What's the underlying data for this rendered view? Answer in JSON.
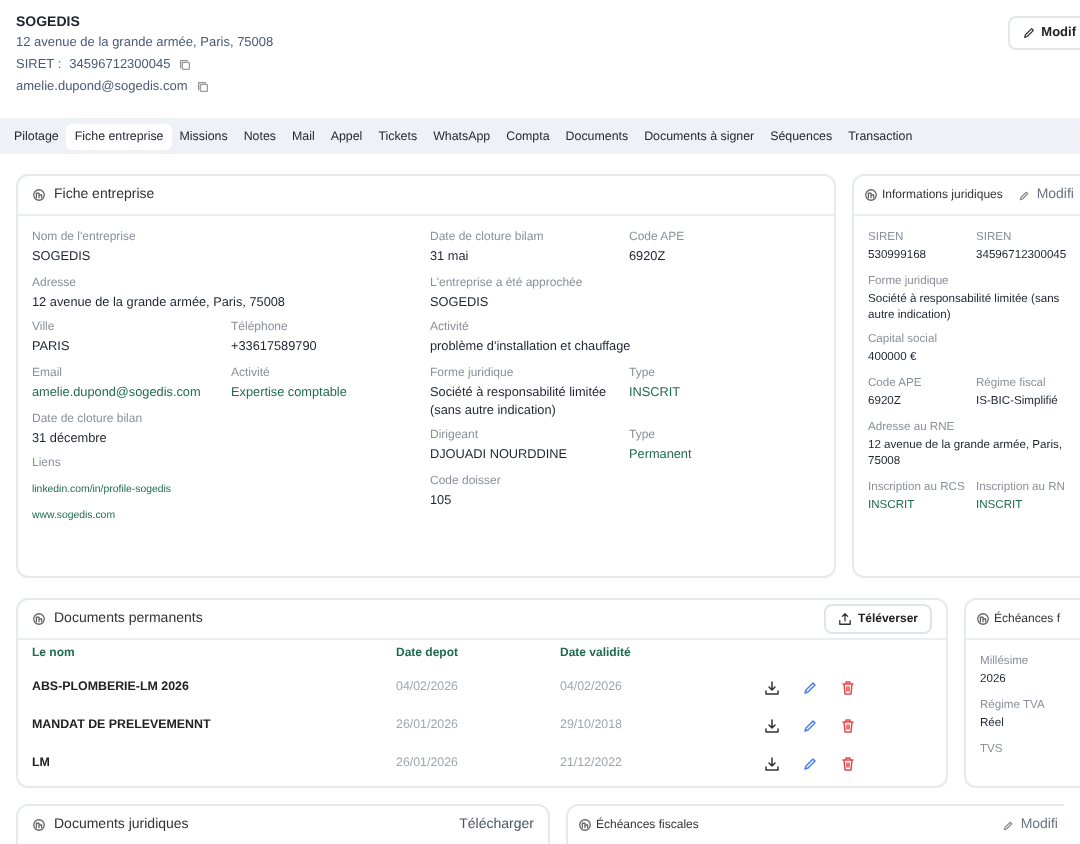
{
  "header": {
    "company": "SOGEDIS",
    "address": "12 avenue de la grande armée, Paris, 75008",
    "siret_label": "SIRET :",
    "siret": "34596712300045",
    "email": "amelie.dupond@sogedis.com",
    "edit_button": "Modif"
  },
  "tabs": [
    {
      "label": "Pilotage",
      "selected": false
    },
    {
      "label": "Fiche entreprise",
      "selected": true
    },
    {
      "label": "Missions",
      "selected": false
    },
    {
      "label": "Notes",
      "selected": false
    },
    {
      "label": "Mail",
      "selected": false
    },
    {
      "label": "Appel",
      "selected": false
    },
    {
      "label": "Tickets",
      "selected": false
    },
    {
      "label": "WhatsApp",
      "selected": false
    },
    {
      "label": "Compta",
      "selected": false
    },
    {
      "label": "Documents",
      "selected": false
    },
    {
      "label": "Documents à signer",
      "selected": false
    },
    {
      "label": "Séquences",
      "selected": false
    },
    {
      "label": "Transaction",
      "selected": false
    }
  ],
  "company_card": {
    "title": "Fiche entreprise",
    "left_rows": [
      [
        {
          "label": "Nom de l'entreprise",
          "value": "SOGEDIS",
          "highlight": false
        }
      ],
      [
        {
          "label": "Adresse",
          "value": "12 avenue de la grande armée, Paris, 75008",
          "highlight": false
        }
      ],
      [
        {
          "label": "Ville",
          "value": "PARIS",
          "highlight": false
        },
        {
          "label": "Téléphone",
          "value": "+33617589790",
          "highlight": false
        }
      ],
      [
        {
          "label": "Email",
          "value": "amelie.dupond@sogedis.com",
          "highlight": true
        },
        {
          "label": "Activité",
          "value": "Expertise comptable",
          "highlight": true
        }
      ],
      [
        {
          "label": "Date de cloture bilan",
          "value": "31 décembre",
          "highlight": false
        }
      ],
      [
        {
          "label": "Liens",
          "links": [
            "linkedin.com/in/profile-sogedis",
            "www.sogedis.com"
          ]
        }
      ]
    ],
    "right_rows": [
      [
        {
          "label": "Date de cloture bilam",
          "value": "31 mai",
          "highlight": false
        },
        {
          "label": "Code APE",
          "value": "6920Z",
          "highlight": false
        }
      ],
      [
        {
          "label": "L'entreprise a été approchée",
          "value": "SOGEDIS",
          "highlight": false
        }
      ],
      [
        {
          "label": "Activité",
          "value": "problème d'installation et chauffage",
          "highlight": false
        }
      ],
      [
        {
          "label": "Forme juridique",
          "value": "Société à responsabilité limitée (sans autre indication)",
          "highlight": false
        },
        {
          "label": "Type",
          "value": "INSCRIT",
          "highlight": true
        }
      ],
      [
        {
          "label": "Dirigeant",
          "value": "DJOUADI NOURDDINE",
          "highlight": false
        },
        {
          "label": "Type",
          "value": "Permanent",
          "highlight": true
        }
      ],
      [
        {
          "label": "Code doisser",
          "value": "105",
          "highlight": false
        }
      ]
    ]
  },
  "legal_card": {
    "title": "Informations juridiques",
    "action": {
      "kind": "edit",
      "label": "Modifi"
    },
    "rows": [
      [
        {
          "label": "SIREN",
          "value": "530999168",
          "highlight": false
        },
        {
          "label": "SIREN",
          "value": "34596712300045",
          "highlight": false
        }
      ],
      [
        {
          "label": "Forme juridique",
          "value": "Société à responsabilité limitée (sans autre indication)",
          "highlight": false
        }
      ],
      [
        {
          "label": "Capital social",
          "value": "400000 €",
          "highlight": false
        }
      ],
      [
        {
          "label": "Code APE",
          "value": "6920Z",
          "highlight": false
        },
        {
          "label": "Régime fiscal",
          "value": "IS-BIC-Simplifié",
          "highlight": false
        }
      ],
      [
        {
          "label": "Adresse au RNE",
          "value": "12 avenue de la grande armée, Paris, 75008",
          "highlight": false
        }
      ],
      [
        {
          "label": "Inscription au RCS",
          "value": "INSCRIT",
          "highlight": true
        },
        {
          "label": "Inscription au RN",
          "value": "INSCRIT",
          "highlight": true
        }
      ]
    ]
  },
  "permanent_documents": {
    "title": "Documents permanents",
    "upload_button": "Téléverser",
    "columns": [
      "Le nom",
      "Date depot",
      "Date validité"
    ],
    "rows": [
      {
        "name": "ABS-PLOMBERIE-LM 2026",
        "date_depot": "04/02/2026",
        "date_validite": "04/02/2026"
      },
      {
        "name": "MANDAT DE PRELEVEMENNT",
        "date_depot": "26/01/2026",
        "date_validite": "29/10/2018"
      },
      {
        "name": "LM",
        "date_depot": "26/01/2026",
        "date_validite": "21/12/2022"
      }
    ]
  },
  "tax_card": {
    "title": "Échéances f",
    "rows": [
      [
        {
          "label": "Millésime",
          "value": "2026",
          "highlight": false
        }
      ],
      [
        {
          "label": "Régime TVA",
          "value": "Réel",
          "highlight": false
        }
      ],
      [
        {
          "label": "TVS"
        }
      ]
    ]
  },
  "legal_documents": {
    "title": "Documents juridiques",
    "action": {
      "kind": "link",
      "label": "Télécharger"
    }
  },
  "tax_deadlines": {
    "title": "Échéances fiscales",
    "action": {
      "kind": "edit",
      "label": "Modifi"
    }
  }
}
